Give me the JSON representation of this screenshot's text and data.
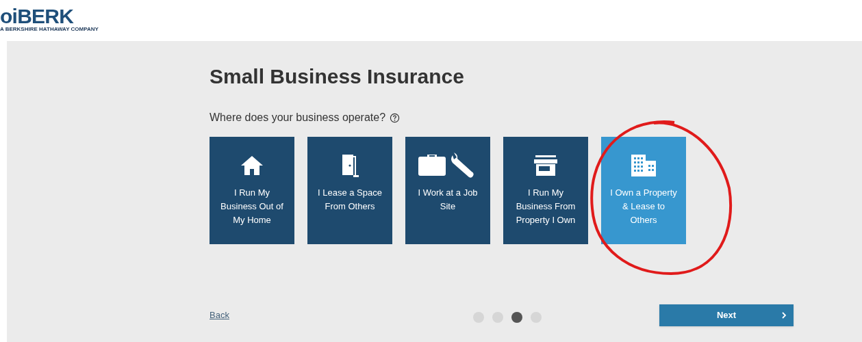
{
  "logo": {
    "name": "oiBERK",
    "tagline": "A BERKSHIRE HATHAWAY COMPANY"
  },
  "title": "Small Business Insurance",
  "question": "Where does your business operate?",
  "options": [
    {
      "kind": "home",
      "label": "I Run My Business Out of My Home",
      "selected": false
    },
    {
      "kind": "door",
      "label": "I Lease a Space From Others",
      "selected": false
    },
    {
      "kind": "tools",
      "label": "I Work at a Job Site",
      "selected": false
    },
    {
      "kind": "store",
      "label": "I Run My Business From Property I Own",
      "selected": false
    },
    {
      "kind": "building",
      "label": "I Own a Property & Lease to Others",
      "selected": true
    }
  ],
  "back": "Back",
  "steps": [
    {
      "selected": false
    },
    {
      "selected": false
    },
    {
      "selected": true
    },
    {
      "selected": false
    }
  ],
  "next": "Next"
}
